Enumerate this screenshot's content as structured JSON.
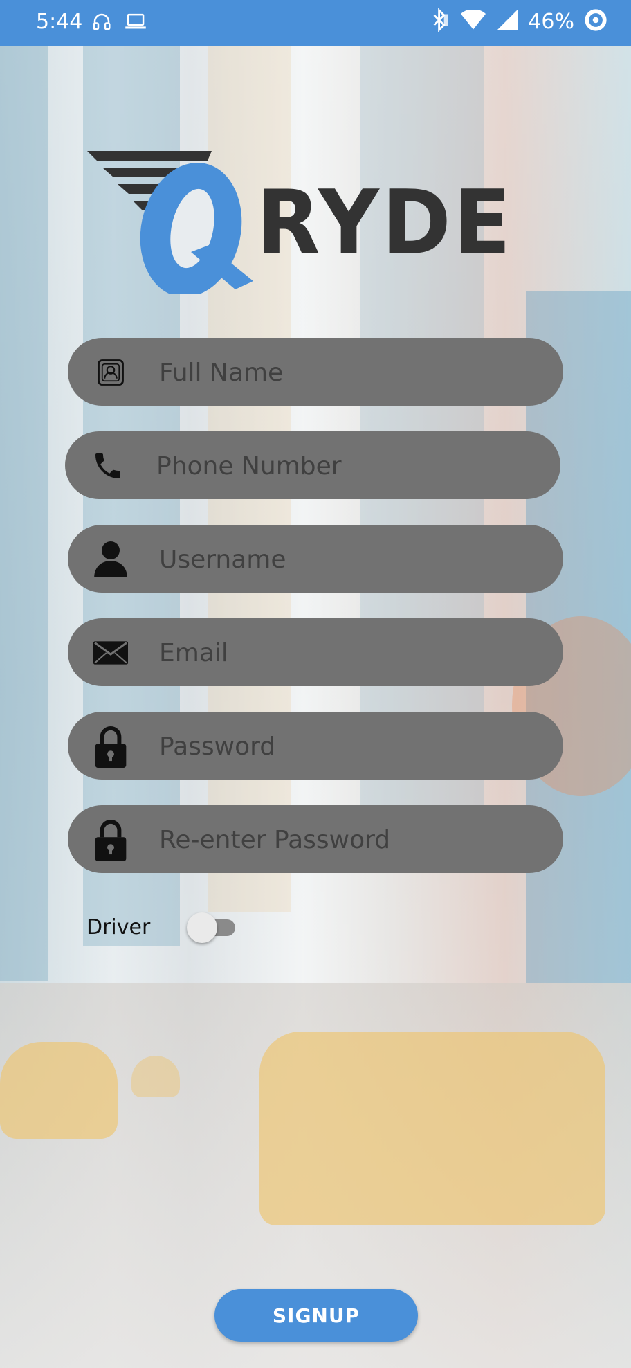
{
  "status_bar": {
    "time": "5:44",
    "battery": "46%",
    "icons": [
      "headphones-icon",
      "laptop-icon",
      "bluetooth-icon",
      "wifi-icon",
      "signal-icon",
      "data-saver-icon"
    ]
  },
  "logo": {
    "text": "QRYDE",
    "colors": {
      "q": "#4a90d9",
      "rest": "#333333"
    }
  },
  "form": {
    "full_name": {
      "placeholder": "Full Name",
      "icon": "id-card-icon"
    },
    "phone": {
      "placeholder": "Phone Number",
      "icon": "phone-icon"
    },
    "username": {
      "placeholder": "Username",
      "icon": "person-icon"
    },
    "email": {
      "placeholder": "Email",
      "icon": "envelope-icon"
    },
    "password": {
      "placeholder": "Password",
      "icon": "lock-icon"
    },
    "reenter_password": {
      "placeholder": "Re-enter Password",
      "icon": "lock-icon"
    }
  },
  "driver": {
    "label": "Driver",
    "enabled": false
  },
  "signup": {
    "label": "SIGNUP"
  },
  "colors": {
    "accent": "#4a90d9",
    "field_bg": "#727272"
  }
}
